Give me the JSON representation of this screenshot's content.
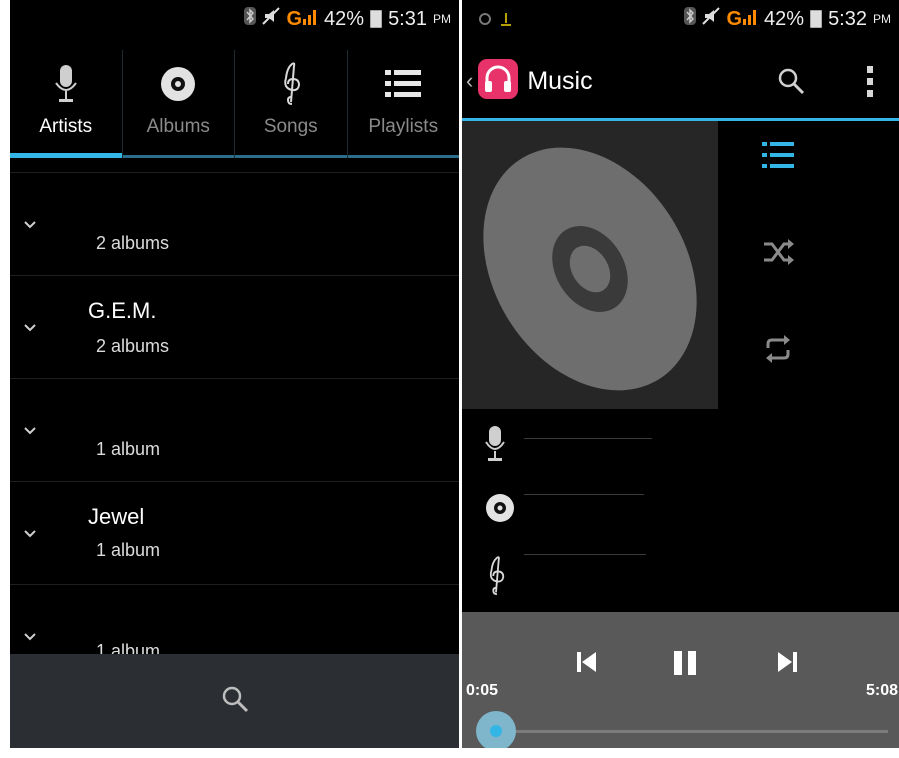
{
  "left": {
    "status": {
      "battery": "42%",
      "time": "5:31",
      "ampm": "PM"
    },
    "tabs": [
      {
        "label": "Artists",
        "icon": "microphone-icon",
        "active": true
      },
      {
        "label": "Albums",
        "icon": "disc-icon",
        "active": false
      },
      {
        "label": "Songs",
        "icon": "treble-clef-icon",
        "active": false
      },
      {
        "label": "Playlists",
        "icon": "list-icon",
        "active": false
      }
    ],
    "artists": [
      {
        "name": "",
        "count": "2 albums"
      },
      {
        "name": "G.E.M.",
        "count": "2 albums"
      },
      {
        "name": "",
        "count": "1 album"
      },
      {
        "name": "Jewel",
        "count": "1 album"
      },
      {
        "name": "",
        "count": "1 album"
      }
    ],
    "bottom_icon": "search-icon"
  },
  "right": {
    "status": {
      "battery": "42%",
      "time": "5:32",
      "ampm": "PM"
    },
    "header": {
      "title": "Music"
    },
    "controls": [
      "queue-list-icon",
      "shuffle-icon",
      "repeat-icon"
    ],
    "player": {
      "elapsed": "0:05",
      "duration": "5:08",
      "progress": 0.016
    }
  },
  "colors": {
    "accent": "#33b5e5",
    "player_bg": "#595959",
    "bottom_bar": "#2b2f33"
  }
}
